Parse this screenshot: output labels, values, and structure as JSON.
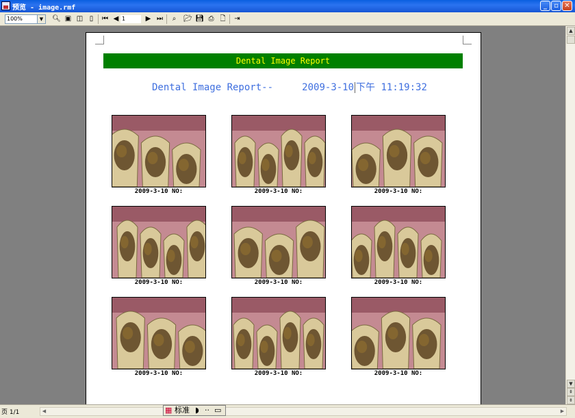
{
  "window": {
    "title": "预览 - image.rmf",
    "minimize": "_",
    "maximize": "▫",
    "close": "✕"
  },
  "toolbar": {
    "zoom_value": "100%",
    "page_field": "1",
    "icons": [
      "search-icon",
      "one-page-icon",
      "two-page-icon",
      "page-width-icon",
      "first-page-icon",
      "prev-page-icon",
      "next-page-icon",
      "last-page-icon",
      "find-icon",
      "open-icon",
      "save-icon",
      "print-icon",
      "new-icon",
      "exit-icon"
    ]
  },
  "report": {
    "banner": "Dental Image Report",
    "heading_left": "Dental Image Report--",
    "heading_date": "2009-3-10",
    "heading_time": "下午 11:19:32",
    "images": [
      {
        "caption": "2009-3-10 NO:"
      },
      {
        "caption": "2009-3-10 NO:"
      },
      {
        "caption": "2009-3-10 NO:"
      },
      {
        "caption": "2009-3-10 NO:"
      },
      {
        "caption": "2009-3-10 NO:"
      },
      {
        "caption": "2009-3-10 NO:"
      },
      {
        "caption": "2009-3-10 NO:"
      },
      {
        "caption": "2009-3-10 NO:"
      },
      {
        "caption": "2009-3-10 NO:"
      }
    ]
  },
  "status": {
    "page_label": "页 1/1"
  },
  "ime": {
    "mode": "标准",
    "moon": "◗",
    "dots": "··",
    "keyboard": "▭"
  },
  "colors": {
    "banner_bg": "#008000",
    "banner_text": "#ffff00",
    "heading": "#3f6fdf"
  }
}
